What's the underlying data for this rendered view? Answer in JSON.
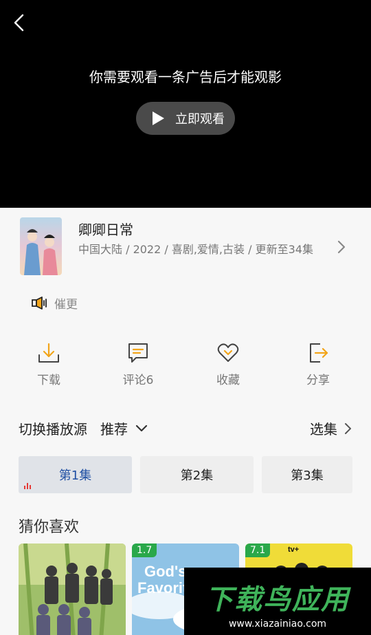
{
  "player": {
    "ad_message": "你需要观看一条广告后才能观影",
    "watch_button": "立即观看"
  },
  "show": {
    "title": "卿卿日常",
    "meta": "中国大陆 / 2022 / 喜剧,爱情,古装 / 更新至34集"
  },
  "cuigeng_label": "催更",
  "actions": [
    {
      "label": "下载",
      "icon": "download-icon"
    },
    {
      "label": "评论6",
      "icon": "comment-icon"
    },
    {
      "label": "收藏",
      "icon": "heart-icon"
    },
    {
      "label": "分享",
      "icon": "share-icon"
    }
  ],
  "source": {
    "label": "切换播放源",
    "selected": "推荐",
    "episodes_link": "选集"
  },
  "episodes": [
    "第1集",
    "第2集",
    "第3集"
  ],
  "recommend": {
    "title": "猜你喜欢",
    "items": [
      {
        "score": null
      },
      {
        "score": "1.7"
      },
      {
        "score": "7.1"
      }
    ]
  },
  "watermark": {
    "brand": "下载鸟应用",
    "url": "www.xiazainiao.com"
  },
  "colors": {
    "accent_green": "#2aa84a",
    "icon_orange": "#f2a51a",
    "active_episode": "#1f4fa3"
  }
}
